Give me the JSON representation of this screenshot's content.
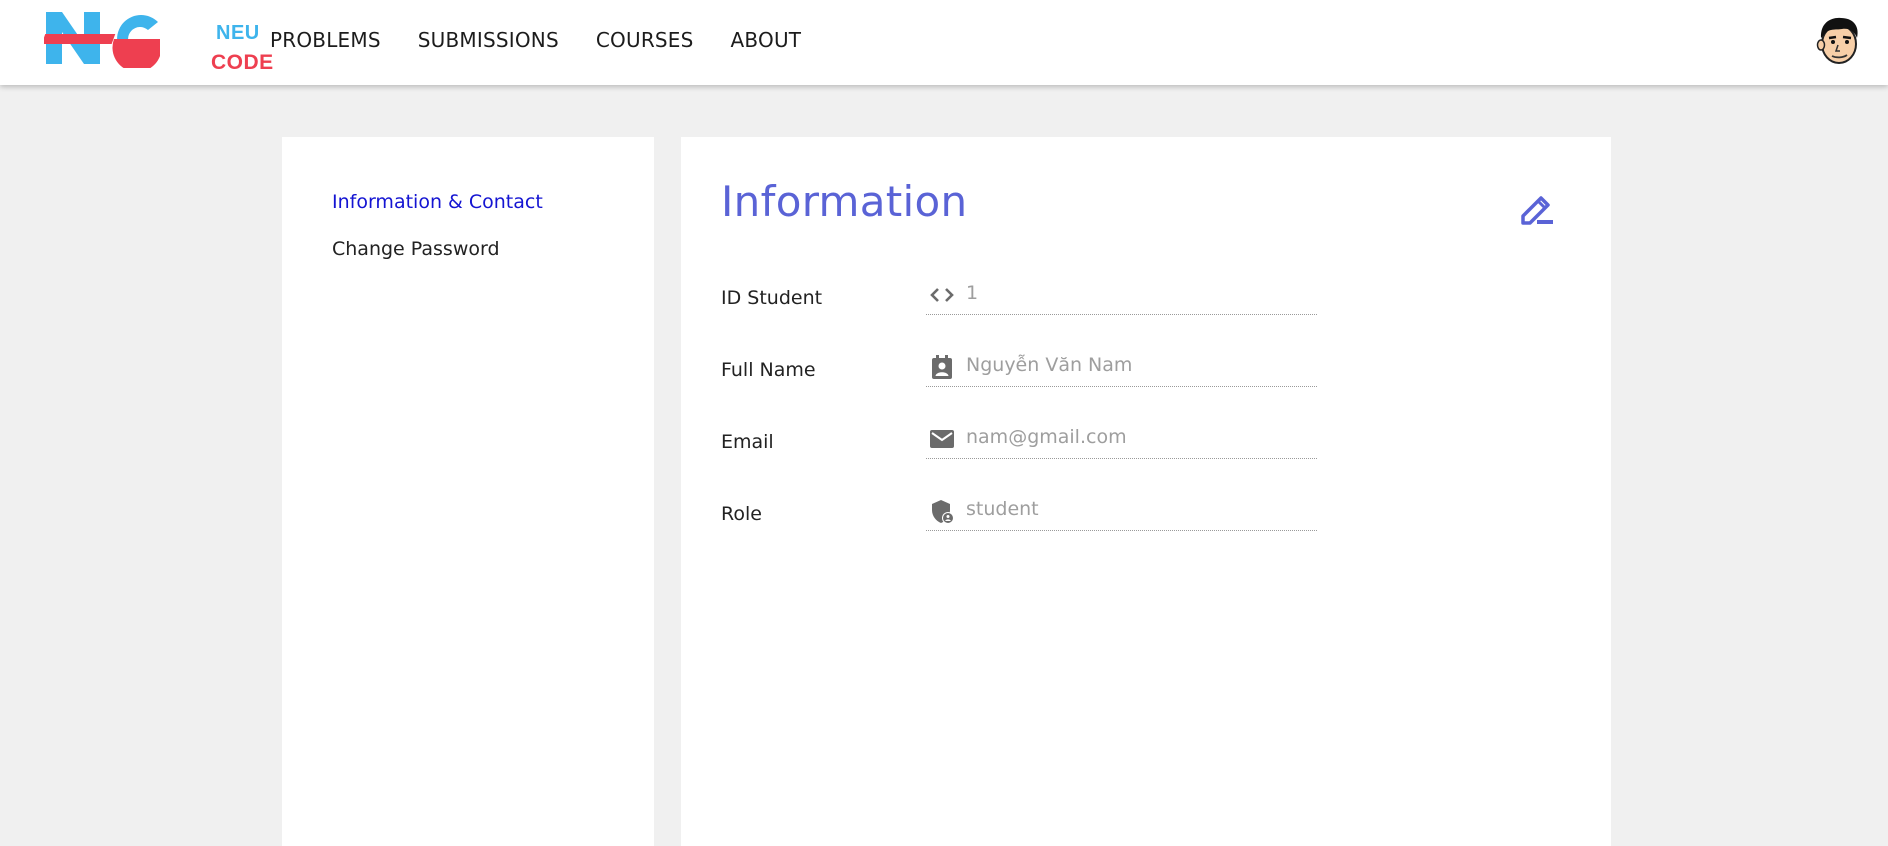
{
  "header": {
    "logo": {
      "word_top": "NEU",
      "word_bottom": "CODE",
      "mark_colors": {
        "blue": "#3eb4ec",
        "red": "#ee3f50"
      }
    },
    "nav": [
      {
        "label": "PROBLEMS"
      },
      {
        "label": "SUBMISSIONS"
      },
      {
        "label": "COURSES"
      },
      {
        "label": "ABOUT"
      }
    ],
    "avatar_icon": "cartoon-face-avatar"
  },
  "sidebar": {
    "items": [
      {
        "label": "Information & Contact",
        "active": true
      },
      {
        "label": "Change Password",
        "active": false
      }
    ]
  },
  "main": {
    "title": "Information",
    "edit_icon": "pencil-edit-icon",
    "fields": [
      {
        "label": "ID Student",
        "value": "1",
        "icon": "code-brackets-icon"
      },
      {
        "label": "Full Name",
        "value": "Nguyễn Văn Nam",
        "icon": "contact-card-icon"
      },
      {
        "label": "Email",
        "value": "nam@gmail.com",
        "icon": "mail-icon"
      },
      {
        "label": "Role",
        "value": "student",
        "icon": "admin-shield-icon"
      }
    ]
  },
  "colors": {
    "accent": "#5a63d6",
    "active_link": "#1414d2",
    "background": "#f0f0f0",
    "field_text": "#9e9e9e"
  }
}
